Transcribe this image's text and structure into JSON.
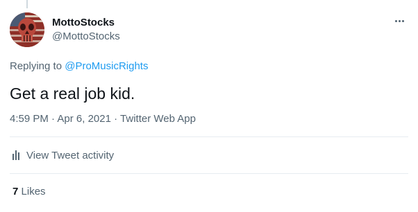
{
  "tweet": {
    "author": {
      "display_name": "MottoStocks",
      "handle": "@MottoStocks",
      "avatar_icon": "skull-flag-avatar"
    },
    "more_icon": "more-dots-icon",
    "replying_to_prefix": "Replying to",
    "replying_to_handle": "@ProMusicRights",
    "text": "Get a real job kid.",
    "time": "4:59 PM",
    "date": "Apr 6, 2021",
    "source": "Twitter Web App",
    "separator": "·",
    "activity_label": "View Tweet activity",
    "activity_icon": "bar-chart-icon",
    "likes_count": "7",
    "likes_label": "Likes"
  },
  "colors": {
    "text_primary": "#0f1419",
    "text_secondary": "#536471",
    "link": "#1d9bf0",
    "divider": "#e7ecf0"
  }
}
